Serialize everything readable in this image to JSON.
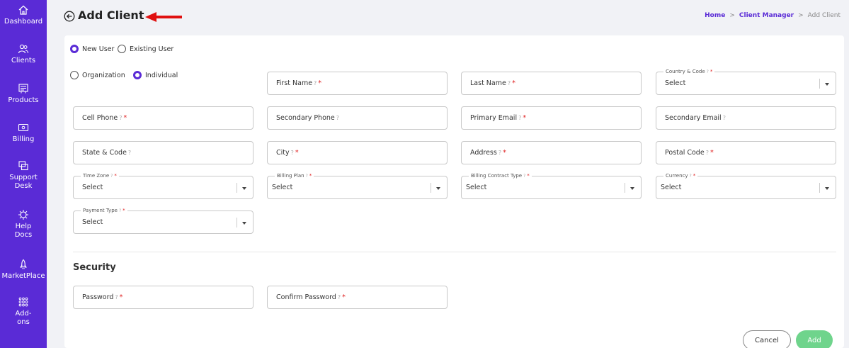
{
  "sidebar": {
    "items": [
      {
        "label": "Dashboard",
        "icon": "home-icon"
      },
      {
        "label": "Clients",
        "icon": "users-icon"
      },
      {
        "label": "Products",
        "icon": "products-icon"
      },
      {
        "label": "Billing",
        "icon": "billing-icon"
      },
      {
        "label": "Support Desk",
        "icon": "support-icon"
      },
      {
        "label": "Help Docs",
        "icon": "help-docs-icon"
      },
      {
        "label": "MarketPlace",
        "icon": "rocket-icon"
      },
      {
        "label": "Add-ons",
        "icon": "grid-icon"
      }
    ]
  },
  "header": {
    "title": "Add Client",
    "breadcrumb": {
      "home": "Home",
      "client_manager": "Client Manager",
      "current": "Add Client",
      "separator": ">"
    }
  },
  "user_type": {
    "new_user": "New User",
    "existing_user": "Existing User"
  },
  "client_type": {
    "organization": "Organization",
    "individual": "Individual"
  },
  "fields": {
    "first_name": "First Name",
    "last_name": "Last Name",
    "country_code": "Country & Code",
    "cell_phone": "Cell Phone",
    "secondary_phone": "Secondary Phone",
    "primary_email": "Primary Email",
    "secondary_email": "Secondary Email",
    "state_code": "State & Code",
    "city": "City",
    "address": "Address",
    "postal_code": "Postal Code",
    "time_zone": "Time Zone",
    "billing_plan": "Billing Plan",
    "billing_contract_type": "Billing Contract Type",
    "currency": "Currency",
    "payment_type": "Payment Type",
    "password": "Password",
    "confirm_password": "Confirm Password"
  },
  "select_value": "Select",
  "help_mark": "?",
  "required_mark": "*",
  "security": {
    "title": "Security"
  },
  "buttons": {
    "cancel": "Cancel",
    "add": "Add"
  },
  "colors": {
    "sidebar": "#5a2bd6",
    "accent": "#5a2bd6",
    "required": "#e02020",
    "add_button": "#6fd48c",
    "annotation_arrow": "#e01010"
  }
}
